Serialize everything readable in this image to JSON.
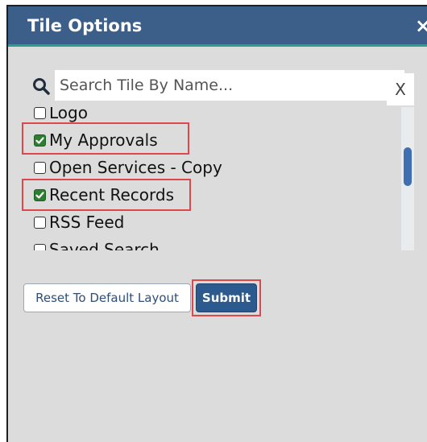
{
  "dialog": {
    "title": "Tile Options",
    "close_label": "×"
  },
  "search": {
    "placeholder": "Search Tile By Name...",
    "value": "",
    "clear_label": "X",
    "icon": "search-icon"
  },
  "tiles": [
    {
      "label": "Logo",
      "checked": false
    },
    {
      "label": "My Approvals",
      "checked": true
    },
    {
      "label": "Open Services - Copy",
      "checked": false
    },
    {
      "label": "Recent Records",
      "checked": true
    },
    {
      "label": "RSS Feed",
      "checked": false
    },
    {
      "label": "Saved Search",
      "checked": false
    }
  ],
  "buttons": {
    "reset_label": "Reset To Default Layout",
    "submit_label": "Submit"
  },
  "colors": {
    "titlebar": "#3c5f8a",
    "accent": "#2e9c92",
    "checkbox_checked": "#2e7d32",
    "highlight": "#e0474c",
    "primary_button": "#2c5a8f"
  }
}
